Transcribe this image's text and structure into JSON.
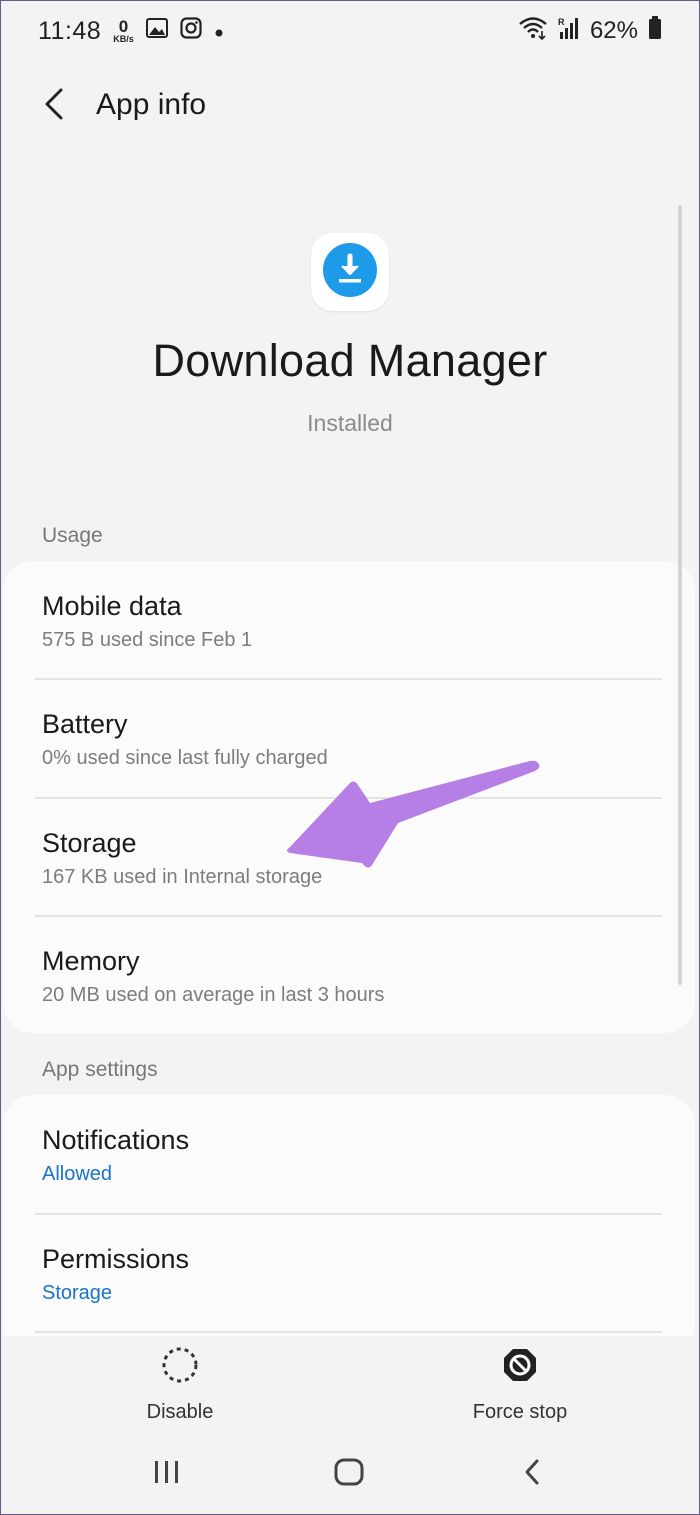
{
  "status_bar": {
    "time": "11:48",
    "net_speed_value": "0",
    "net_speed_unit": "KB/s",
    "battery_percent": "62%",
    "icons": [
      "image-icon",
      "instagram-icon",
      "dot-icon",
      "wifi-icon",
      "signal-icon",
      "battery-icon"
    ]
  },
  "header": {
    "title": "App info"
  },
  "app": {
    "name": "Download Manager",
    "status": "Installed",
    "icon": "download-icon",
    "icon_color": "#1e9be8"
  },
  "usage": {
    "label": "Usage",
    "items": [
      {
        "title": "Mobile data",
        "subtitle": "575 B used since Feb 1"
      },
      {
        "title": "Battery",
        "subtitle": "0% used since last fully charged"
      },
      {
        "title": "Storage",
        "subtitle": "167 KB used in Internal storage"
      },
      {
        "title": "Memory",
        "subtitle": "20 MB used on average in last 3 hours"
      }
    ]
  },
  "app_settings": {
    "label": "App settings",
    "items": [
      {
        "title": "Notifications",
        "subtitle": "Allowed"
      },
      {
        "title": "Permissions",
        "subtitle": "Storage"
      }
    ],
    "link_color": "#1a73c8"
  },
  "actions": {
    "disable_label": "Disable",
    "force_stop_label": "Force stop"
  },
  "annotation": {
    "arrow_color": "#b57fe6",
    "points_to": "Storage"
  }
}
